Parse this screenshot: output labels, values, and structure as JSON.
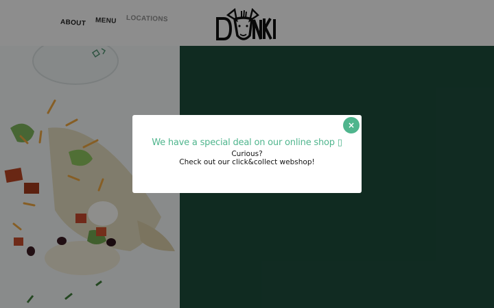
{
  "nav": {
    "items": [
      {
        "label": "ABOUT"
      },
      {
        "label": "MENU"
      },
      {
        "label": "LOCATIONS"
      }
    ]
  },
  "logo": {
    "text": "DONKI"
  },
  "modal": {
    "title": "We have a special deal on our online shop ▯",
    "line1": "Curious?",
    "line2": "Check out our click&collect webshop!",
    "close_label": "×"
  },
  "colors": {
    "brand_green": "#4fb58d",
    "dark_green": "#1d4a3a",
    "header_bg": "#f3f3f3"
  }
}
